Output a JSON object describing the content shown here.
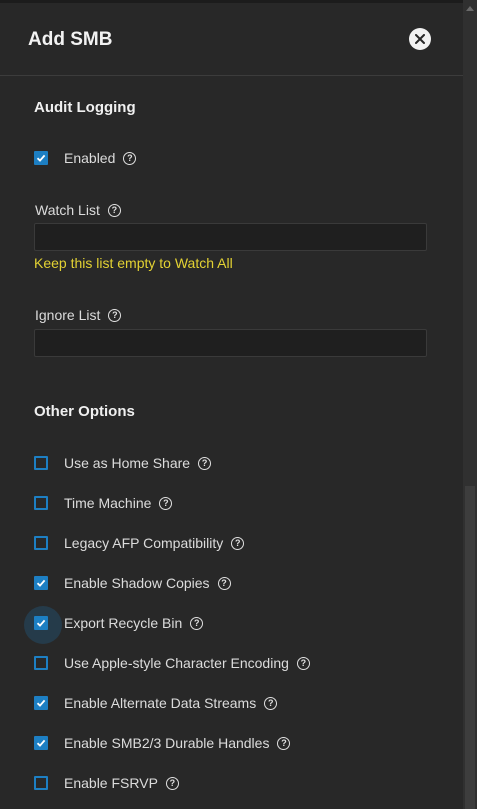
{
  "dialog": {
    "title": "Add SMB"
  },
  "icons": {
    "close": "close-icon",
    "help": "help-icon",
    "check": "check-icon"
  },
  "colors": {
    "accent": "#1d7fc3",
    "hint": "#e3d233",
    "background": "#282828"
  },
  "audit": {
    "section_title": "Audit Logging",
    "enabled": {
      "label": "Enabled",
      "checked": true
    },
    "watch_list": {
      "label": "Watch List",
      "value": "",
      "hint": "Keep this list empty to Watch All"
    },
    "ignore_list": {
      "label": "Ignore List",
      "value": ""
    }
  },
  "other": {
    "section_title": "Other Options",
    "options": [
      {
        "label": "Use as Home Share",
        "checked": false
      },
      {
        "label": "Time Machine",
        "checked": false
      },
      {
        "label": "Legacy AFP Compatibility",
        "checked": false
      },
      {
        "label": "Enable Shadow Copies",
        "checked": true
      },
      {
        "label": "Export Recycle Bin",
        "checked": true,
        "focused": true
      },
      {
        "label": "Use Apple-style Character Encoding",
        "checked": false
      },
      {
        "label": "Enable Alternate Data Streams",
        "checked": true
      },
      {
        "label": "Enable SMB2/3 Durable Handles",
        "checked": true
      },
      {
        "label": "Enable FSRVP",
        "checked": false
      }
    ]
  }
}
